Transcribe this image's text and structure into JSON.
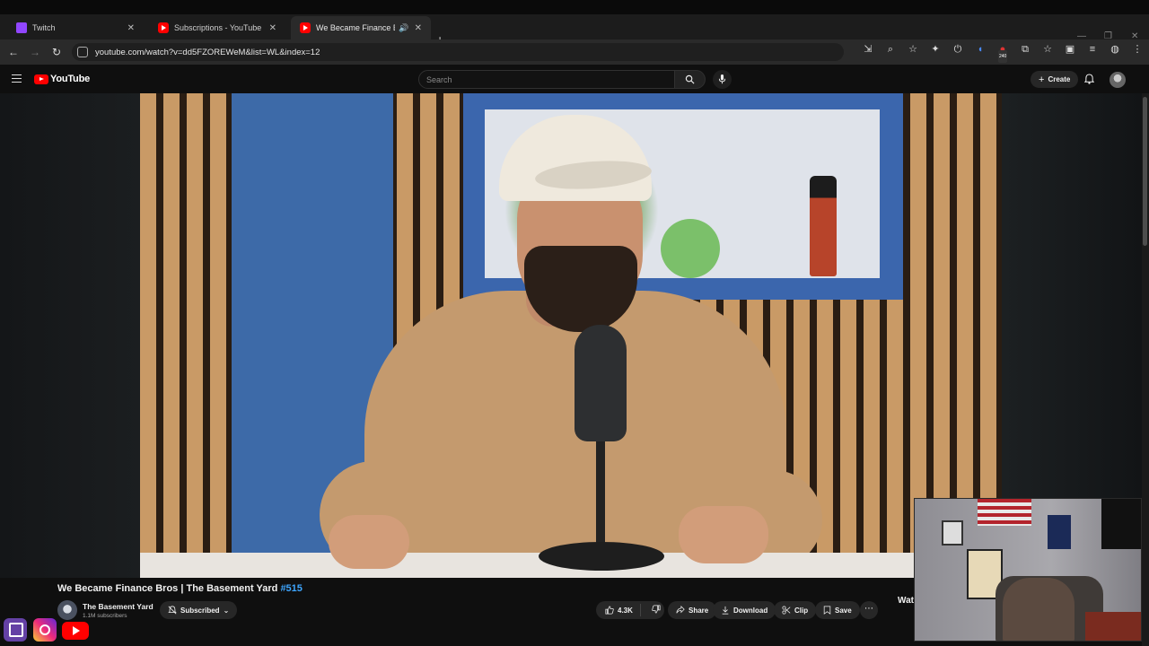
{
  "browser": {
    "tabs": [
      {
        "label": "Twitch",
        "favicon": "twitch-favicon",
        "active": false
      },
      {
        "label": "Subscriptions - YouTube",
        "favicon": "youtube-favicon",
        "active": false
      },
      {
        "label": "We Became Finance Bros | T",
        "favicon": "youtube-favicon",
        "active": true,
        "audio": true
      }
    ],
    "url": "youtube.com/watch?v=dd5FZOREWeM&list=WL&index=12",
    "extension_badge": "240"
  },
  "youtube": {
    "logo_text": "YouTube",
    "search_placeholder": "Search",
    "create_label": "Create"
  },
  "video": {
    "title": "We Became Finance Bros | The Basement Yard ",
    "hashtag": "#515",
    "channel_name": "The Basement Yard",
    "subscribers": "1.1M subscribers",
    "subscribed_label": "Subscribed",
    "likes": "4.3K",
    "share_label": "Share",
    "download_label": "Download",
    "clip_label": "Clip",
    "save_label": "Save",
    "up_next_peek": "Wat"
  },
  "colors": {
    "background": "#0f0f0f",
    "accent_red": "#ff0000",
    "link_blue": "#3ea6ff",
    "pill_gray": "#272727"
  }
}
